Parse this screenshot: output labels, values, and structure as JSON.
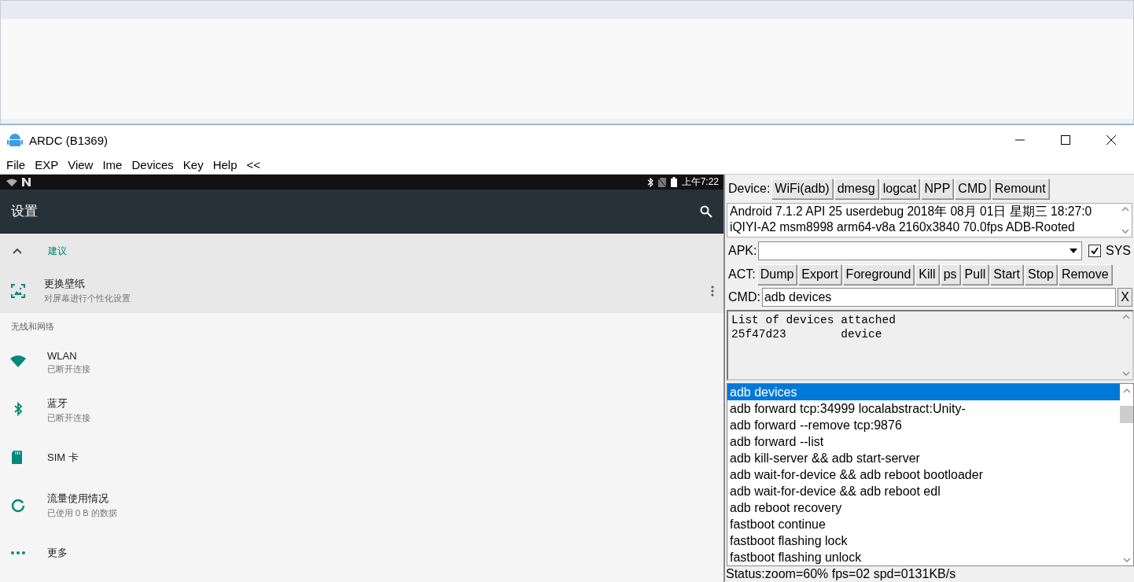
{
  "window": {
    "title": "ARDC (B1369)"
  },
  "menu": [
    "File",
    "EXP",
    "View",
    "Ime",
    "Devices",
    "Key",
    "Help",
    "<<"
  ],
  "phone": {
    "status_time": "上午7:22",
    "app_title": "设置",
    "suggestion": {
      "header": "建议",
      "expanded": true,
      "title": "更换壁纸",
      "subtitle": "对屏幕进行个性化设置"
    },
    "section": "无线和网络",
    "items": [
      {
        "kind": "wifi",
        "title": "WLAN",
        "subtitle": "已断开连接"
      },
      {
        "kind": "bluetooth",
        "title": "蓝牙",
        "subtitle": "已断开连接"
      },
      {
        "kind": "sim",
        "title": "SIM 卡"
      },
      {
        "kind": "data",
        "title": "流量使用情况",
        "subtitle": "已使用 0 B 的数据"
      },
      {
        "kind": "more",
        "title": "更多"
      }
    ]
  },
  "device_bar": {
    "label": "Device:",
    "buttons": [
      "WiFi(adb)",
      "dmesg",
      "logcat",
      "NPP",
      "CMD",
      "Remount"
    ]
  },
  "info": [
    "Android 7.1.2 API 25 userdebug 2018年 08月 01日 星期三 18:27:0",
    "iQIYI-A2 msm8998 arm64-v8a 2160x3840 70.0fps ADB-Rooted"
  ],
  "apk": {
    "label": "APK:",
    "sys": {
      "label": "SYS",
      "checked": true
    }
  },
  "act": {
    "label": "ACT:",
    "buttons": [
      "Dump",
      "Export",
      "Foreground",
      "Kill",
      "ps",
      "Pull",
      "Start",
      "Stop",
      "Remove"
    ]
  },
  "cmd": {
    "label": "CMD:",
    "value": "adb devices",
    "clear": "X"
  },
  "output": [
    "List of devices attached",
    "25f47d23        device"
  ],
  "history": [
    {
      "text": "adb devices",
      "selected": true
    },
    {
      "text": "adb forward tcp:34999 localabstract:Unity-",
      "selected": false
    },
    {
      "text": "adb forward --remove tcp:9876",
      "selected": false
    },
    {
      "text": "adb forward --list",
      "selected": false
    },
    {
      "text": "adb kill-server && adb start-server",
      "selected": false
    },
    {
      "text": "adb wait-for-device && adb reboot bootloader",
      "selected": false
    },
    {
      "text": "adb wait-for-device && adb reboot edl",
      "selected": false
    },
    {
      "text": "adb reboot recovery",
      "selected": false
    },
    {
      "text": "fastboot continue",
      "selected": false
    },
    {
      "text": "fastboot flashing lock",
      "selected": false
    },
    {
      "text": "fastboot flashing unlock",
      "selected": false
    }
  ],
  "status": "Status:zoom=60% fps=02 spd=0131KB/s"
}
